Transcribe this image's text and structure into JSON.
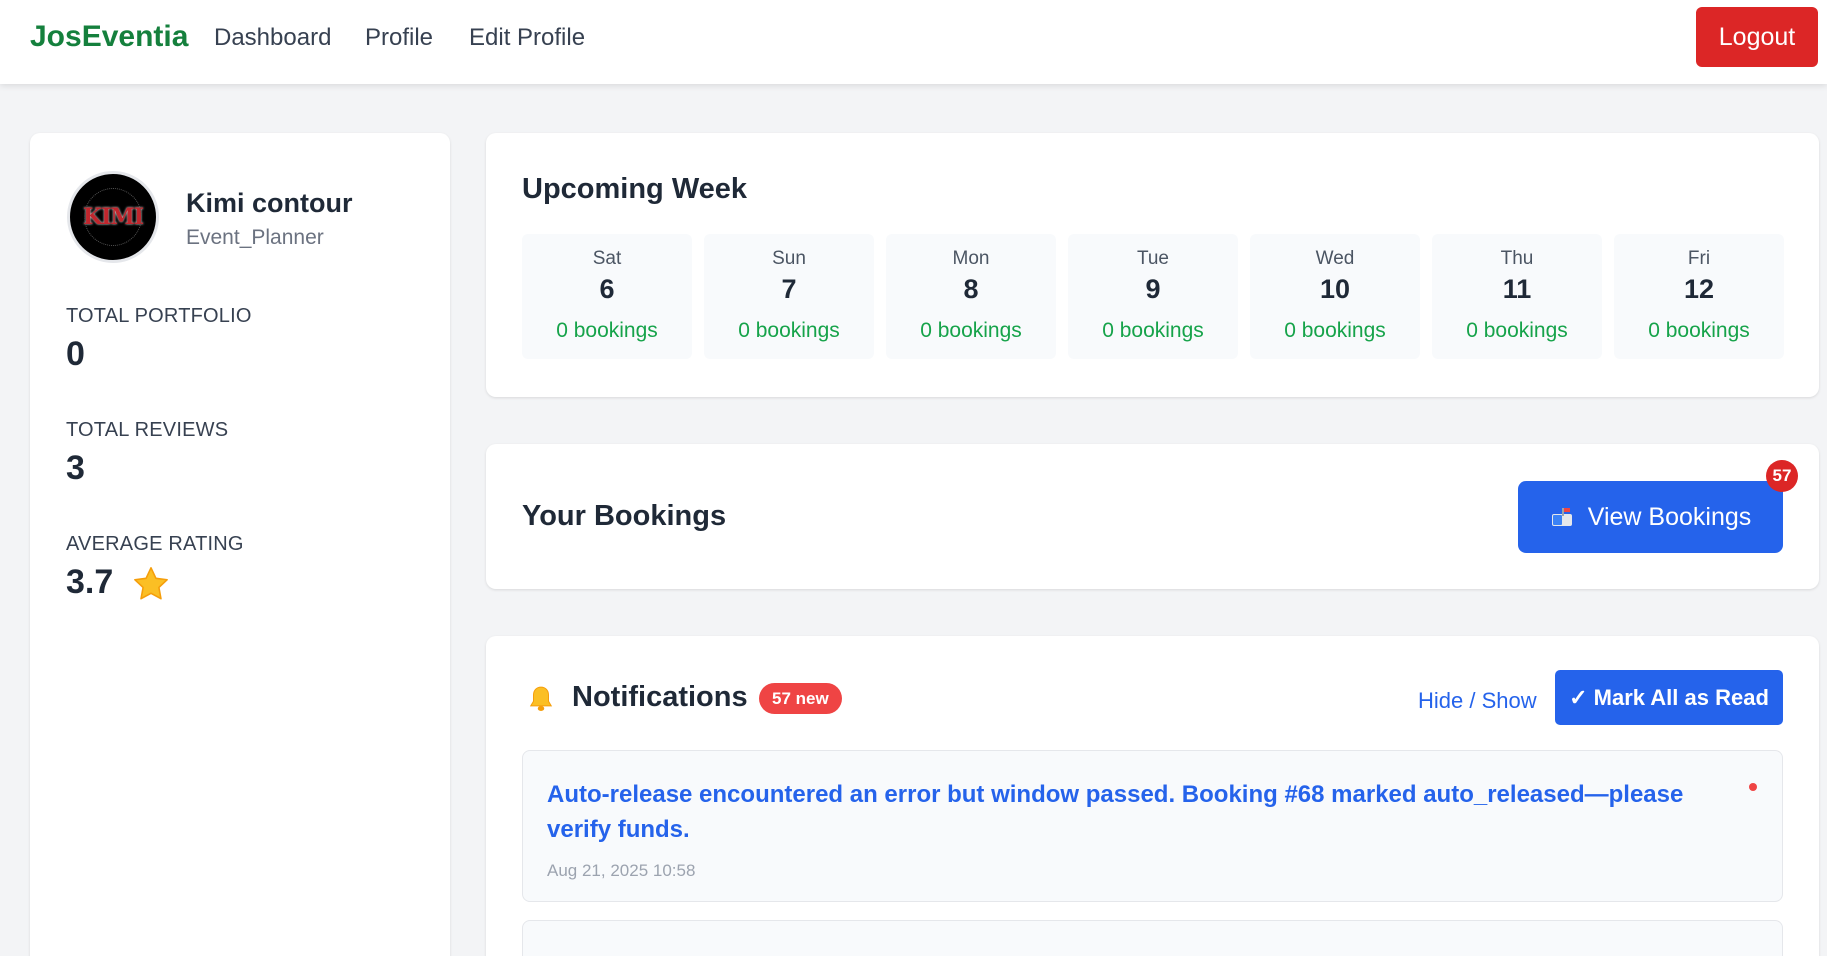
{
  "nav": {
    "brand": "JosEventia",
    "links": [
      "Dashboard",
      "Profile",
      "Edit Profile"
    ],
    "logout": "Logout"
  },
  "profile": {
    "avatar_text": "KIMI",
    "name": "Kimi contour",
    "role": "Event_Planner",
    "stats": [
      {
        "label": "TOTAL PORTFOLIO",
        "value": "0"
      },
      {
        "label": "TOTAL REVIEWS",
        "value": "3"
      },
      {
        "label": "AVERAGE RATING",
        "value": "3.7"
      }
    ],
    "rating_icon": "star-icon"
  },
  "week": {
    "title": "Upcoming Week",
    "days": [
      {
        "name": "Sat",
        "num": "6",
        "bookings": "0 bookings"
      },
      {
        "name": "Sun",
        "num": "7",
        "bookings": "0 bookings"
      },
      {
        "name": "Mon",
        "num": "8",
        "bookings": "0 bookings"
      },
      {
        "name": "Tue",
        "num": "9",
        "bookings": "0 bookings"
      },
      {
        "name": "Wed",
        "num": "10",
        "bookings": "0 bookings"
      },
      {
        "name": "Thu",
        "num": "11",
        "bookings": "0 bookings"
      },
      {
        "name": "Fri",
        "num": "12",
        "bookings": "0 bookings"
      }
    ]
  },
  "bookings": {
    "title": "Your Bookings",
    "button_label": "View Bookings",
    "button_icon": "mailbox-icon",
    "badge": "57"
  },
  "notifications": {
    "title": "Notifications",
    "new_badge": "57 new",
    "toggle": "Hide / Show",
    "mark_all": "✓ Mark All as Read",
    "items": [
      {
        "message": "Auto-release encountered an error but window passed. Booking #68 marked auto_released—please verify funds.",
        "time": "Aug 21, 2025 10:58",
        "unread": true
      }
    ]
  },
  "colors": {
    "brand": "#15803d",
    "primary": "#2563eb",
    "danger": "#dc2626",
    "success": "#16a34a"
  }
}
